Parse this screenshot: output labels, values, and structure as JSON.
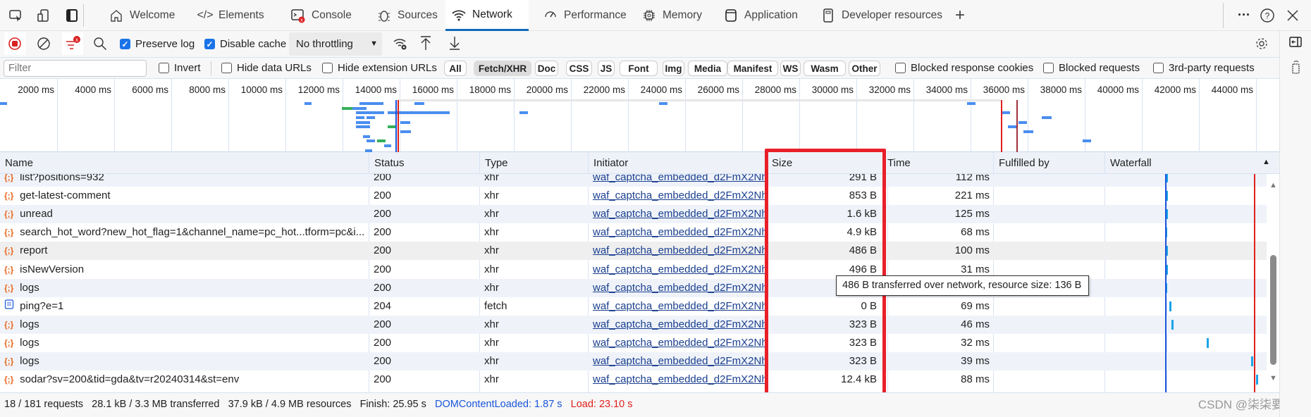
{
  "tabbar": {
    "tabs": [
      {
        "label": "Welcome",
        "icon": "home-icon"
      },
      {
        "label": "Elements",
        "icon": "code-icon"
      },
      {
        "label": "Console",
        "icon": "console-icon"
      },
      {
        "label": "Sources",
        "icon": "bug-icon"
      },
      {
        "label": "Network",
        "icon": "wifi-icon",
        "active": true
      },
      {
        "label": "Performance",
        "icon": "gauge-icon"
      },
      {
        "label": "Memory",
        "icon": "chip-icon"
      },
      {
        "label": "Application",
        "icon": "app-icon"
      },
      {
        "label": "Developer resources",
        "icon": "device-icon"
      }
    ]
  },
  "toolbar": {
    "preserve_log": {
      "label": "Preserve log",
      "checked": true
    },
    "disable_cache": {
      "label": "Disable cache",
      "checked": true
    },
    "throttling": "No throttling"
  },
  "filterbar": {
    "filter_placeholder": "Filter",
    "invert": "Invert",
    "hide_data_urls": "Hide data URLs",
    "hide_extension_urls": "Hide extension URLs",
    "types": [
      "All",
      "Fetch/XHR",
      "Doc",
      "CSS",
      "JS",
      "Font",
      "Img",
      "Media",
      "Manifest",
      "WS",
      "Wasm",
      "Other"
    ],
    "active_type": "Fetch/XHR",
    "blocked_response_cookies": "Blocked response cookies",
    "blocked_requests": "Blocked requests",
    "third_party": "3rd-party requests"
  },
  "overview": {
    "ticks": [
      "2000 ms",
      "4000 ms",
      "6000 ms",
      "8000 ms",
      "10000 ms",
      "12000 ms",
      "14000 ms",
      "16000 ms",
      "18000 ms",
      "20000 ms",
      "22000 ms",
      "24000 ms",
      "26000 ms",
      "28000 ms",
      "30000 ms",
      "32000 ms",
      "34000 ms",
      "36000 ms",
      "38000 ms",
      "40000 ms",
      "42000 ms",
      "44000 ms"
    ]
  },
  "table": {
    "columns": [
      "Name",
      "Status",
      "Type",
      "Initiator",
      "Size",
      "Time",
      "Fulfilled by",
      "Waterfall"
    ],
    "rows": [
      {
        "name": "list?positions=932",
        "status": "200",
        "type": "xhr",
        "initiator": "waf_captcha_embedded_d2FmX2Nh...",
        "size": "291 B",
        "time": "112 ms",
        "icon": "xhr"
      },
      {
        "name": "get-latest-comment",
        "status": "200",
        "type": "xhr",
        "initiator": "waf_captcha_embedded_d2FmX2Nh...",
        "size": "853 B",
        "time": "221 ms",
        "icon": "xhr"
      },
      {
        "name": "unread",
        "status": "200",
        "type": "xhr",
        "initiator": "waf_captcha_embedded_d2FmX2Nh...",
        "size": "1.6 kB",
        "time": "125 ms",
        "icon": "xhr"
      },
      {
        "name": "search_hot_word?new_hot_flag=1&channel_name=pc_hot...tform=pc&i...",
        "status": "200",
        "type": "xhr",
        "initiator": "waf_captcha_embedded_d2FmX2Nh...",
        "size": "4.9 kB",
        "time": "68 ms",
        "icon": "xhr"
      },
      {
        "name": "report",
        "status": "200",
        "type": "xhr",
        "initiator": "waf_captcha_embedded_d2FmX2Nh...",
        "size": "486 B",
        "time": "100 ms",
        "icon": "xhr"
      },
      {
        "name": "isNewVersion",
        "status": "200",
        "type": "xhr",
        "initiator": "waf_captcha_embedded_d2FmX2Nh...",
        "size": "496 B",
        "time": "31 ms",
        "icon": "xhr"
      },
      {
        "name": "logs",
        "status": "200",
        "type": "xhr",
        "initiator": "waf_captcha_embedded_d2FmX2Nh...",
        "size": "",
        "time": "",
        "icon": "xhr"
      },
      {
        "name": "ping?e=1",
        "status": "204",
        "type": "fetch",
        "initiator": "waf_captcha_embedded_d2FmX2Nh...",
        "size": "0 B",
        "time": "69 ms",
        "icon": "doc"
      },
      {
        "name": "logs",
        "status": "200",
        "type": "xhr",
        "initiator": "waf_captcha_embedded_d2FmX2Nh...",
        "size": "323 B",
        "time": "46 ms",
        "icon": "xhr"
      },
      {
        "name": "logs",
        "status": "200",
        "type": "xhr",
        "initiator": "waf_captcha_embedded_d2FmX2Nh...",
        "size": "323 B",
        "time": "32 ms",
        "icon": "xhr"
      },
      {
        "name": "logs",
        "status": "200",
        "type": "xhr",
        "initiator": "waf_captcha_embedded_d2FmX2Nh...",
        "size": "323 B",
        "time": "39 ms",
        "icon": "xhr"
      },
      {
        "name": "sodar?sv=200&tid=gda&tv=r20240314&st=env",
        "status": "200",
        "type": "xhr",
        "initiator": "waf_captcha_embedded_d2FmX2Nh...",
        "size": "12.4 kB",
        "time": "88 ms",
        "icon": "xhr"
      }
    ]
  },
  "tooltip": "486 B transferred over network, resource size: 136 B",
  "status": {
    "requests": "18 / 181 requests",
    "transferred": "28.1 kB / 3.3 MB transferred",
    "resources": "37.9 kB / 4.9 MB resources",
    "finish": "Finish: 25.95 s",
    "dom": "DOMContentLoaded: 1.87 s",
    "load": "Load: 23.10 s"
  },
  "watermark": "CSDN @柒柒要开心",
  "colors": {
    "accent": "#0f6cbd",
    "highlight_box": "#e8202a",
    "dom_line": "#1a56db",
    "load_line": "#e0201c",
    "xhr_icon": "#e8681e"
  }
}
